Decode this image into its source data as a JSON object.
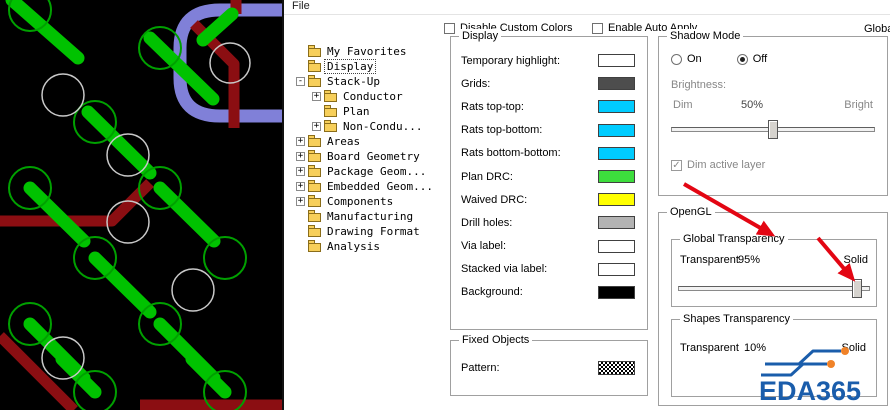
{
  "menu": {
    "file": "File"
  },
  "header": {
    "disable_custom_colors": "Disable Custom Colors",
    "enable_auto_apply": "Enable Auto Apply",
    "clipped_right_text": "Globa"
  },
  "tree": {
    "items": [
      {
        "label": "My Favorites",
        "expander": "",
        "level": 0
      },
      {
        "label": "Display",
        "expander": "",
        "level": 0,
        "selected": true
      },
      {
        "label": "Stack-Up",
        "expander": "-",
        "level": 0
      },
      {
        "label": "Conductor",
        "expander": "+",
        "level": 1
      },
      {
        "label": "Plan",
        "expander": "",
        "level": 1
      },
      {
        "label": "Non-Condu...",
        "expander": "+",
        "level": 1
      },
      {
        "label": "Areas",
        "expander": "+",
        "level": 0
      },
      {
        "label": "Board Geometry",
        "expander": "+",
        "level": 0
      },
      {
        "label": "Package Geom...",
        "expander": "+",
        "level": 0
      },
      {
        "label": "Embedded Geom...",
        "expander": "+",
        "level": 0
      },
      {
        "label": "Components",
        "expander": "+",
        "level": 0
      },
      {
        "label": "Manufacturing",
        "expander": "",
        "level": 0
      },
      {
        "label": "Drawing Format",
        "expander": "",
        "level": 0
      },
      {
        "label": "Analysis",
        "expander": "",
        "level": 0
      }
    ]
  },
  "display_group": {
    "title": "Display",
    "rows": [
      {
        "label": "Temporary highlight:",
        "color": "#ffffff"
      },
      {
        "label": "Grids:",
        "color": "#4d4d4d"
      },
      {
        "label": "Rats top-top:",
        "color": "#00ccff"
      },
      {
        "label": "Rats top-bottom:",
        "color": "#00ccff"
      },
      {
        "label": "Rats bottom-bottom:",
        "color": "#00ccff"
      },
      {
        "label": "Plan DRC:",
        "color": "#3ddd3d"
      },
      {
        "label": "Waived DRC:",
        "color": "#ffff00"
      },
      {
        "label": "Drill holes:",
        "color": "#b3b3b3"
      },
      {
        "label": "Via label:",
        "color": "#ffffff"
      },
      {
        "label": "Stacked via label:",
        "color": "#ffffff"
      },
      {
        "label": "Background:",
        "color": "#000000"
      }
    ]
  },
  "fixed_objects": {
    "title": "Fixed Objects",
    "pattern_label": "Pattern:"
  },
  "shadow_mode": {
    "title": "Shadow Mode",
    "on": "On",
    "off": "Off",
    "selected": "Off",
    "brightness": "Brightness:",
    "dim": "Dim",
    "value": "50%",
    "bright": "Bright",
    "dim_active_layer": "Dim active layer",
    "dim_active_checked": true
  },
  "opengl": {
    "title": "OpenGL",
    "global_transparency": {
      "title": "Global Transparency",
      "left": "Transparent",
      "value": "95%",
      "right": "Solid"
    },
    "shapes_transparency": {
      "title": "Shapes Transparency",
      "left": "Transparent",
      "value": "10%",
      "right": "Solid"
    }
  },
  "watermark": {
    "text": "EDA365",
    "brand_blue": "#1a5dab",
    "accent_orange": "#f08228"
  },
  "annotations": {
    "arrow_color": "#e30613"
  },
  "pcb_preview": {
    "background": "#000000",
    "trace_green": "#00c200",
    "trace_red": "#8b0e12",
    "trace_blue": "#8080d8",
    "pad_green": "#00a000",
    "pad_white": "#c8c8c8"
  }
}
